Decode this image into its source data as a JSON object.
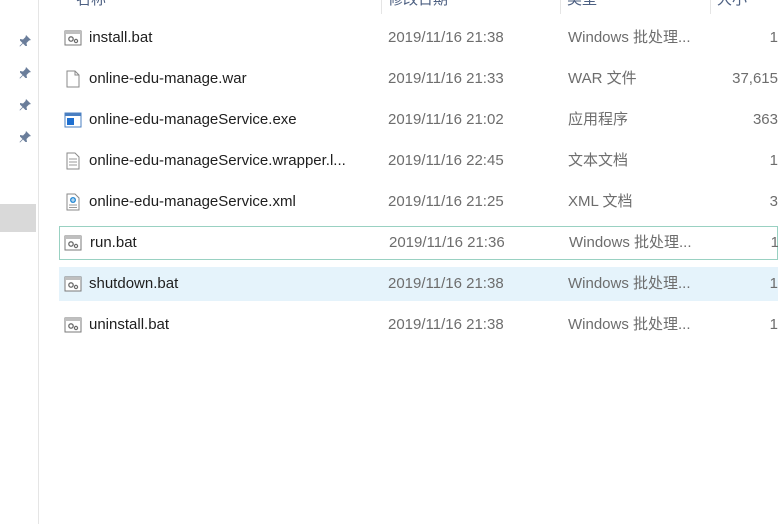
{
  "header": {
    "columns": [
      "名称",
      "修改日期",
      "类型",
      "大小"
    ]
  },
  "navpane": {
    "pins": [
      "pin-icon",
      "pin-icon",
      "pin-icon",
      "pin-icon"
    ]
  },
  "files": [
    {
      "name": "install.bat",
      "date": "2019/11/16 21:38",
      "type": "Windows 批处理...",
      "size": "1",
      "icon": "batch-file-icon"
    },
    {
      "name": "online-edu-manage.war",
      "date": "2019/11/16 21:33",
      "type": "WAR 文件",
      "size": "37,615",
      "icon": "generic-file-icon"
    },
    {
      "name": "online-edu-manageService.exe",
      "date": "2019/11/16 21:02",
      "type": "应用程序",
      "size": "363",
      "icon": "application-icon"
    },
    {
      "name": "online-edu-manageService.wrapper.l...",
      "date": "2019/11/16 22:45",
      "type": "文本文档",
      "size": "1",
      "icon": "text-file-icon"
    },
    {
      "name": "online-edu-manageService.xml",
      "date": "2019/11/16 21:25",
      "type": "XML 文档",
      "size": "3",
      "icon": "xml-file-icon"
    },
    {
      "name": "run.bat",
      "date": "2019/11/16 21:36",
      "type": "Windows 批处理...",
      "size": "1",
      "icon": "batch-file-icon"
    },
    {
      "name": "shutdown.bat",
      "date": "2019/11/16 21:38",
      "type": "Windows 批处理...",
      "size": "1",
      "icon": "batch-file-icon"
    },
    {
      "name": "uninstall.bat",
      "date": "2019/11/16 21:38",
      "type": "Windows 批处理...",
      "size": "1",
      "icon": "batch-file-icon"
    }
  ],
  "colors": {
    "selected_row": "#e5f3fb",
    "focus_border": "#99d1c2",
    "header_text": "#4d6082"
  }
}
